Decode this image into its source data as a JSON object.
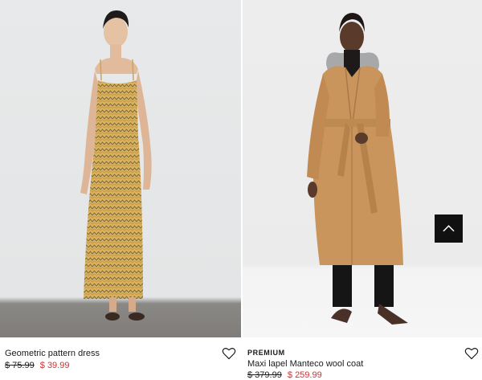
{
  "products": [
    {
      "badge": "",
      "name": "Geometric pattern dress",
      "old_price": "$ 75.99",
      "new_price": "$ 39.99",
      "image_icon": "dress-photo"
    },
    {
      "badge": "PREMIUM",
      "name": "Maxi lapel Manteco wool coat",
      "old_price": "$ 379.99",
      "new_price": "$ 259.99",
      "image_icon": "coat-photo"
    }
  ],
  "colors": {
    "sale_price": "#d0312d",
    "scroll_button": "#111111"
  },
  "icons": {
    "favorite": "heart-icon",
    "scroll_top": "chevron-up-icon"
  }
}
